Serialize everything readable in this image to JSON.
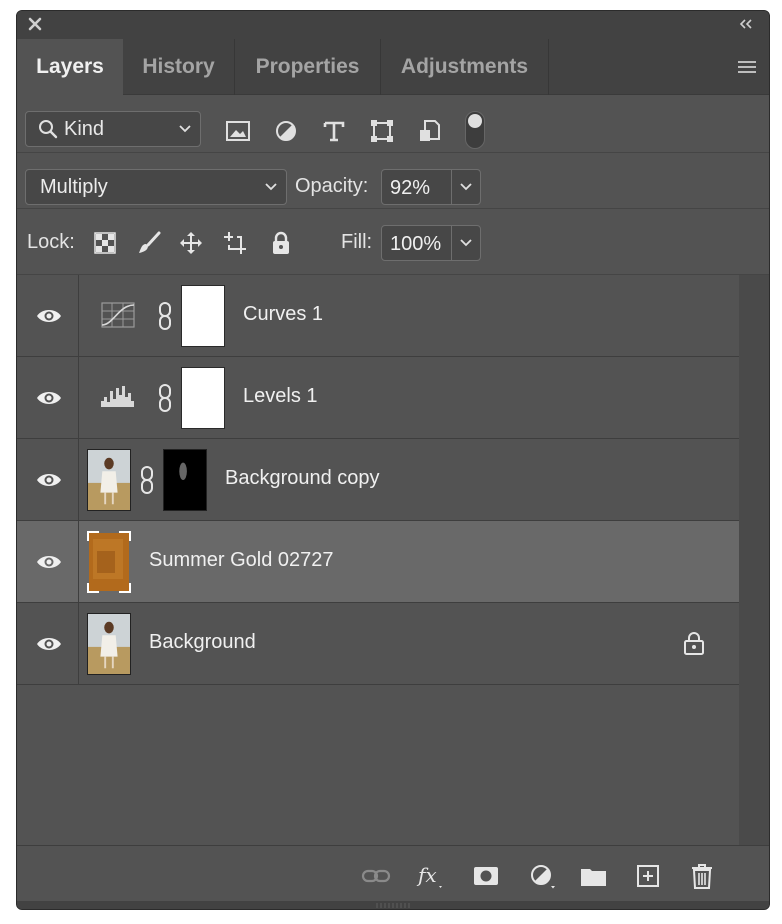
{
  "tabs": [
    {
      "label": "Layers"
    },
    {
      "label": "History"
    },
    {
      "label": "Properties"
    },
    {
      "label": "Adjustments"
    }
  ],
  "filter": {
    "kind_label": "Kind"
  },
  "blend": {
    "mode": "Multiply",
    "opacity_label": "Opacity:",
    "opacity_value": "92%"
  },
  "lock": {
    "label": "Lock:",
    "fill_label": "Fill:",
    "fill_value": "100%"
  },
  "layers": [
    {
      "name": "Curves 1",
      "type": "curves-adjustment",
      "visible": true
    },
    {
      "name": "Levels 1",
      "type": "levels-adjustment",
      "visible": true
    },
    {
      "name": "Background copy",
      "type": "image-with-mask",
      "visible": true
    },
    {
      "name": "Summer Gold 02727",
      "type": "texture-image",
      "visible": true,
      "selected": true
    },
    {
      "name": "Background",
      "type": "image",
      "visible": true,
      "locked": true
    }
  ],
  "colors": {
    "panel": "#535353",
    "tabbar": "#424242",
    "selected_row": "#696969",
    "texture": "#b26a1c"
  }
}
